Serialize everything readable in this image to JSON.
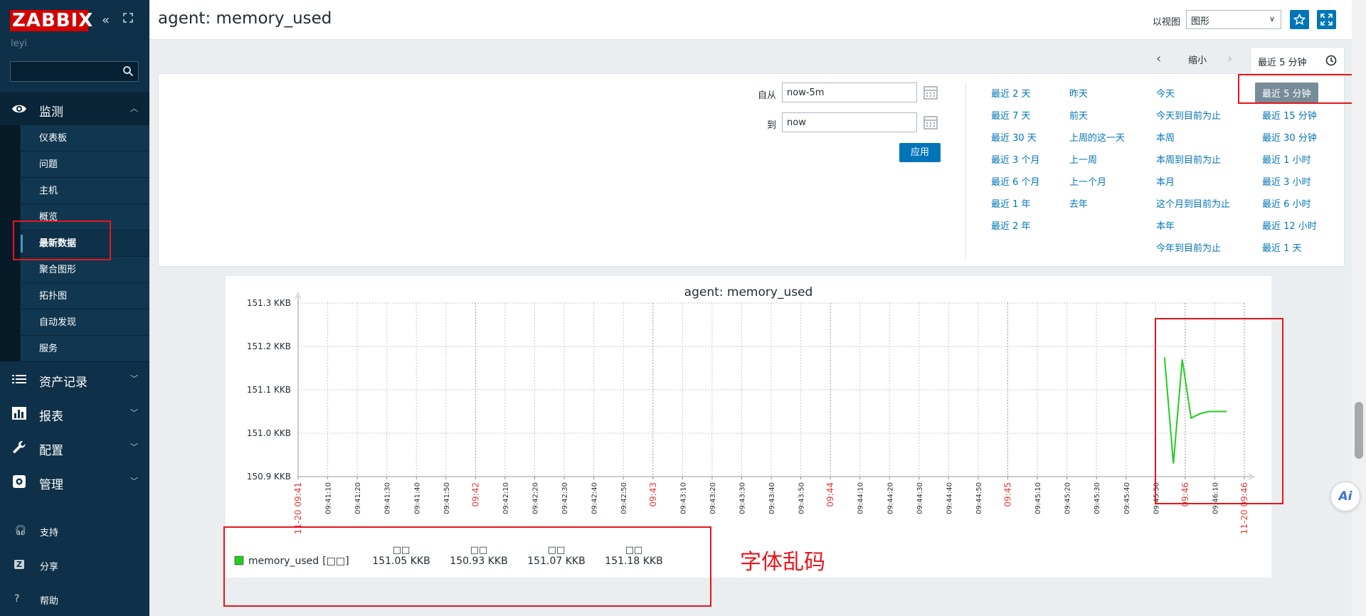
{
  "brand": {
    "logo": "ZABBIX",
    "user": "leyi"
  },
  "sidebar": {
    "monitor_label": "监测",
    "monitor_items": [
      "仪表板",
      "问题",
      "主机",
      "概览",
      "最新数据",
      "聚合图形",
      "拓扑图",
      "自动发现",
      "服务"
    ],
    "menus": [
      "资产记录",
      "报表",
      "配置",
      "管理"
    ],
    "bottom": [
      "支持",
      "分享",
      "帮助"
    ]
  },
  "header": {
    "title": "agent: memory_used",
    "view_as_label": "以视图",
    "view_as_value": "图形"
  },
  "time_nav": {
    "zoom_out": "缩小",
    "range_tab": "最近 5 分钟"
  },
  "filter": {
    "from_label": "自从",
    "from_value": "now-5m",
    "to_label": "到",
    "to_value": "now",
    "apply": "应用",
    "quick_cols": [
      [
        "最近 2 天",
        "最近 7 天",
        "最近 30 天",
        "最近 3 个月",
        "最近 6 个月",
        "最近 1 年",
        "最近 2 年"
      ],
      [
        "昨天",
        "前天",
        "上周的这一天",
        "上一周",
        "上一个月",
        "去年"
      ],
      [
        "今天",
        "今天到目前为止",
        "本周",
        "本周到目前为止",
        "本月",
        "这个月到目前为止",
        "本年",
        "今年到目前为止"
      ],
      [
        "最近 5 分钟",
        "最近 15 分钟",
        "最近 30 分钟",
        "最近 1 小时",
        "最近 3 小时",
        "最近 6 小时",
        "最近 12 小时",
        "最近 1 天"
      ]
    ],
    "selected": "最近 5 分钟"
  },
  "chart_data": {
    "type": "line",
    "title": "agent: memory_used",
    "y_ticks": [
      "151.3 KKB",
      "151.2 KKB",
      "151.1 KKB",
      "151.0 KKB",
      "150.9 KKB"
    ],
    "ylim": [
      150.9,
      151.3
    ],
    "x_ticks": [
      "11-20 09:41",
      "09:41:10",
      "09:41:20",
      "09:41:30",
      "09:41:40",
      "09:41:50",
      "09:42",
      "09:42:10",
      "09:42:20",
      "09:42:30",
      "09:42:40",
      "09:42:50",
      "09:43",
      "09:43:10",
      "09:43:20",
      "09:43:30",
      "09:43:40",
      "09:43:50",
      "09:44",
      "09:44:10",
      "09:44:20",
      "09:44:30",
      "09:44:40",
      "09:44:50",
      "09:45",
      "09:45:10",
      "09:45:20",
      "09:45:30",
      "09:45:40",
      "09:45:50",
      "09:46",
      "09:46:10",
      "11-20 09:46"
    ],
    "red_ticks": [
      "11-20 09:41",
      "09:42",
      "09:43",
      "09:44",
      "09:45",
      "09:46",
      "11-20 09:46"
    ],
    "series": [
      {
        "name": "memory_used",
        "color": "#22cc22",
        "x_seconds": [
          293,
          296,
          299,
          302,
          305,
          308,
          311,
          314
        ],
        "values": [
          151.175,
          150.93,
          151.17,
          151.035,
          151.045,
          151.05,
          151.05,
          151.05
        ]
      }
    ],
    "legend": {
      "name": "memory_used",
      "func": "[□□]",
      "stats": [
        {
          "head": "□□",
          "value": "151.05 KKB"
        },
        {
          "head": "□□",
          "value": "150.93 KKB"
        },
        {
          "head": "□□",
          "value": "151.07 KKB"
        },
        {
          "head": "□□",
          "value": "151.18 KKB"
        }
      ]
    }
  },
  "annotation": {
    "text": "字体乱码"
  },
  "ai_widget": "Ai"
}
